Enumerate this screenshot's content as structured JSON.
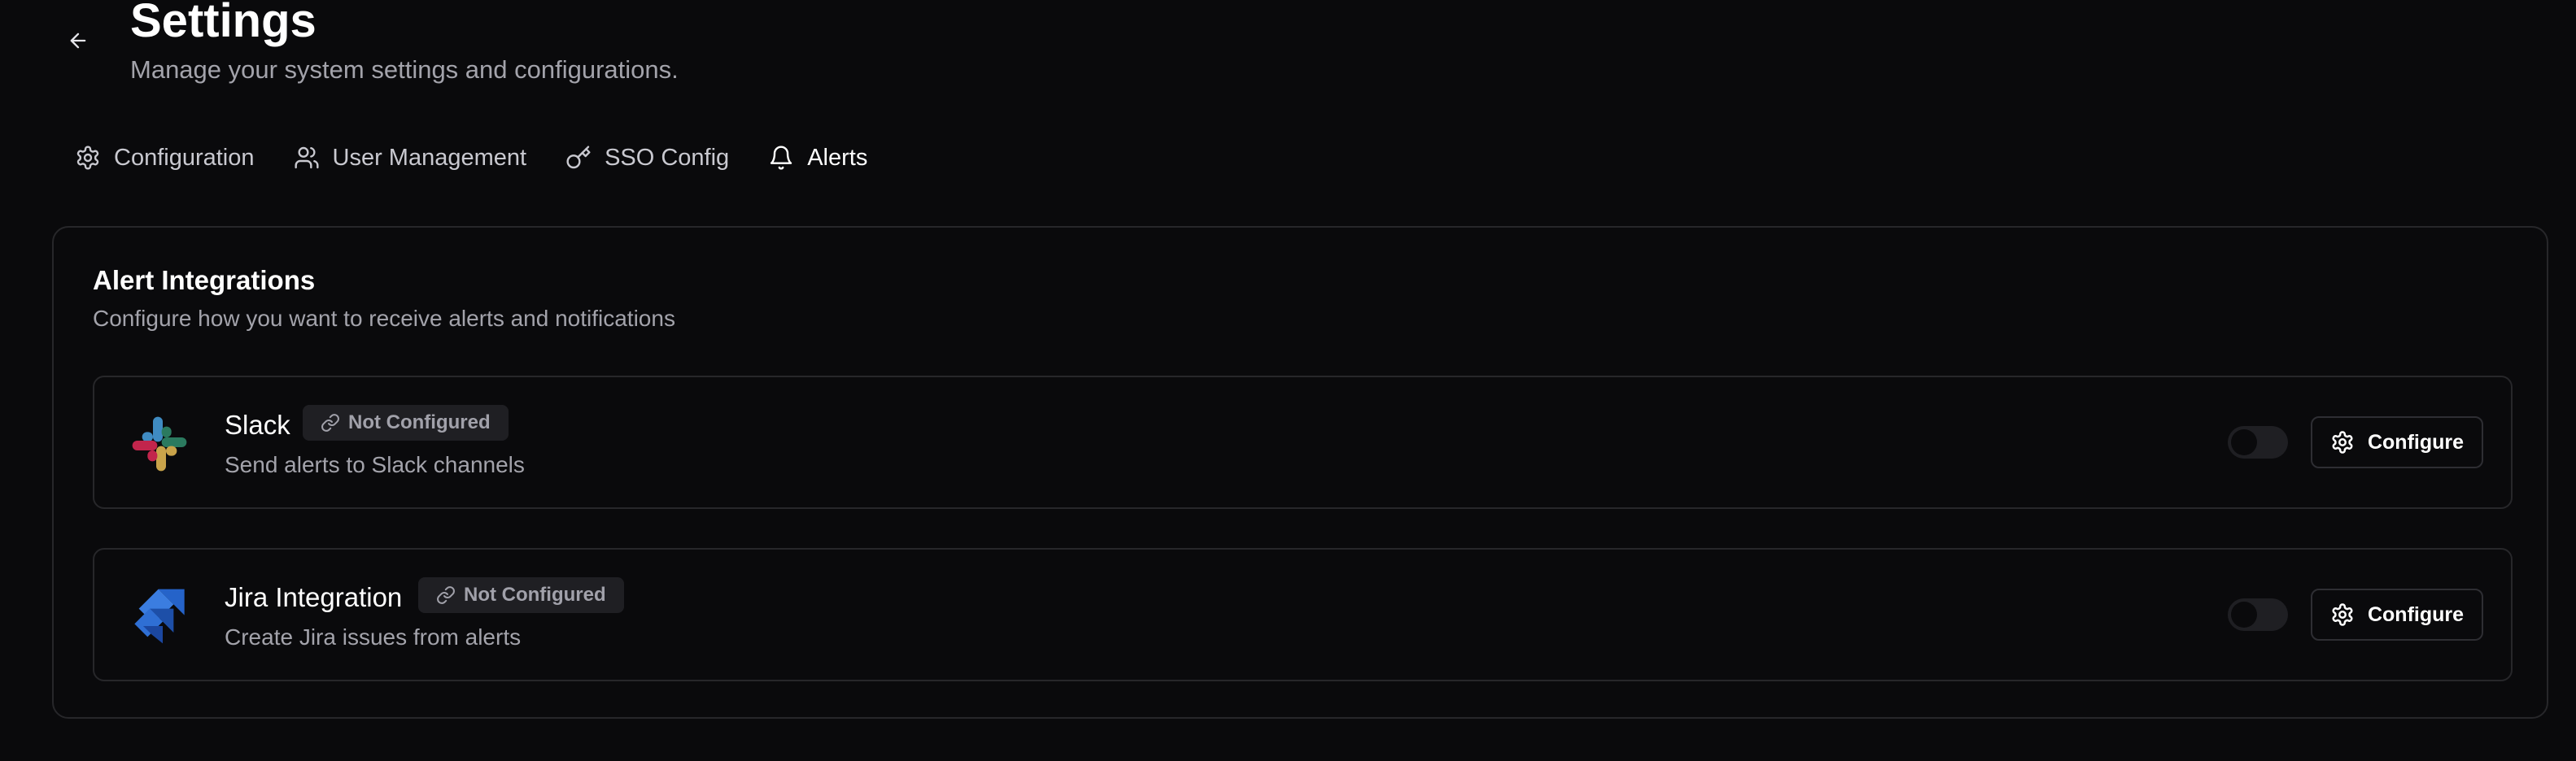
{
  "header": {
    "title": "Settings",
    "subtitle": "Manage your system settings and configurations."
  },
  "tabs": [
    {
      "label": "Configuration",
      "icon": "gear-icon",
      "active": false
    },
    {
      "label": "User Management",
      "icon": "users-icon",
      "active": false
    },
    {
      "label": "SSO Config",
      "icon": "key-icon",
      "active": false
    },
    {
      "label": "Alerts",
      "icon": "bell-icon",
      "active": true
    }
  ],
  "alerts_card": {
    "title": "Alert Integrations",
    "description": "Configure how you want to receive alerts and notifications",
    "integrations": [
      {
        "name": "Slack",
        "status": "Not Configured",
        "description": "Send alerts to Slack channels",
        "enabled": false,
        "button_label": "Configure",
        "logo": "slack-logo"
      },
      {
        "name": "Jira Integration",
        "status": "Not Configured",
        "description": "Create Jira issues from alerts",
        "enabled": false,
        "button_label": "Configure",
        "logo": "jira-logo"
      }
    ]
  },
  "colors": {
    "background": "#0a0a0c",
    "border": "#27272a",
    "text_primary": "#ffffff",
    "text_muted": "#a3a3ab",
    "badge_bg": "#1f1f23",
    "jira_blue": "#2563c9",
    "slack_red": "#c2254c",
    "slack_green": "#2b7a5f",
    "slack_blue": "#3f8bc2",
    "slack_yellow": "#c9a34a"
  }
}
